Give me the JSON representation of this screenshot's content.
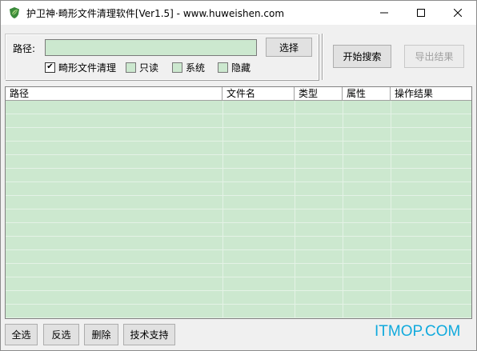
{
  "window": {
    "title": "护卫神·畸形文件清理软件[Ver1.5] - www.huweishen.com",
    "icon": "shield-leaf-icon",
    "controls": {
      "minimize": "minimize-icon",
      "maximize": "maximize-icon",
      "close": "close-icon"
    }
  },
  "path": {
    "label": "路径:",
    "value": "",
    "select_button": "选择"
  },
  "options": [
    {
      "label": "畸形文件清理",
      "checked": true
    },
    {
      "label": "只读",
      "checked": false
    },
    {
      "label": "系统",
      "checked": false
    },
    {
      "label": "隐藏",
      "checked": false
    }
  ],
  "actions": {
    "search_button": "开始搜索",
    "export_button": "导出结果",
    "export_enabled": false
  },
  "table": {
    "columns": [
      "路径",
      "文件名",
      "类型",
      "属性",
      "操作结果"
    ],
    "rows": []
  },
  "bottom": {
    "select_all": "全选",
    "invert": "反选",
    "delete": "删除",
    "support": "技术支持"
  },
  "watermark": "ITMOP.COM",
  "colors": {
    "grid_background": "#cce8cf",
    "watermark": "#11aadd"
  }
}
